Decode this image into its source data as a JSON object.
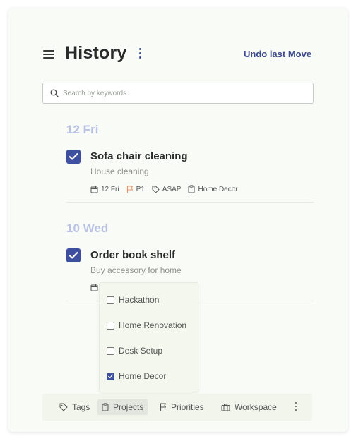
{
  "header": {
    "title": "History",
    "undo_label": "Undo last Move"
  },
  "search": {
    "placeholder": "Search by keywords",
    "value": ""
  },
  "groups": [
    {
      "date_label": "12 Fri",
      "task": {
        "title": "Sofa chair cleaning",
        "subtitle": "House cleaning",
        "checked": true,
        "meta": {
          "date": "12 Fri",
          "priority": "P1",
          "tag": "ASAP",
          "project": "Home Decor"
        }
      }
    },
    {
      "date_label": "10 Wed",
      "task": {
        "title": "Order book shelf",
        "subtitle": "Buy accessory for home",
        "checked": true
      }
    }
  ],
  "project_popup": {
    "options": [
      {
        "label": "Hackathon",
        "checked": false
      },
      {
        "label": "Home Renovation",
        "checked": false
      },
      {
        "label": "Desk Setup",
        "checked": false
      },
      {
        "label": "Home Decor",
        "checked": true
      }
    ]
  },
  "toolbar": {
    "tags": "Tags",
    "projects": "Projects",
    "priorities": "Priorities",
    "workspace": "Workspace"
  },
  "colors": {
    "accent": "#3f4fa0",
    "date_heading": "#b9c2e6",
    "priority_flag": "#e8956b",
    "card_bg": "#f9fbf6"
  },
  "icons": [
    "menu-icon",
    "kebab-icon",
    "search-icon",
    "checkmark-icon",
    "calendar-icon",
    "flag-icon",
    "tag-icon",
    "clipboard-icon",
    "briefcase-icon"
  ]
}
